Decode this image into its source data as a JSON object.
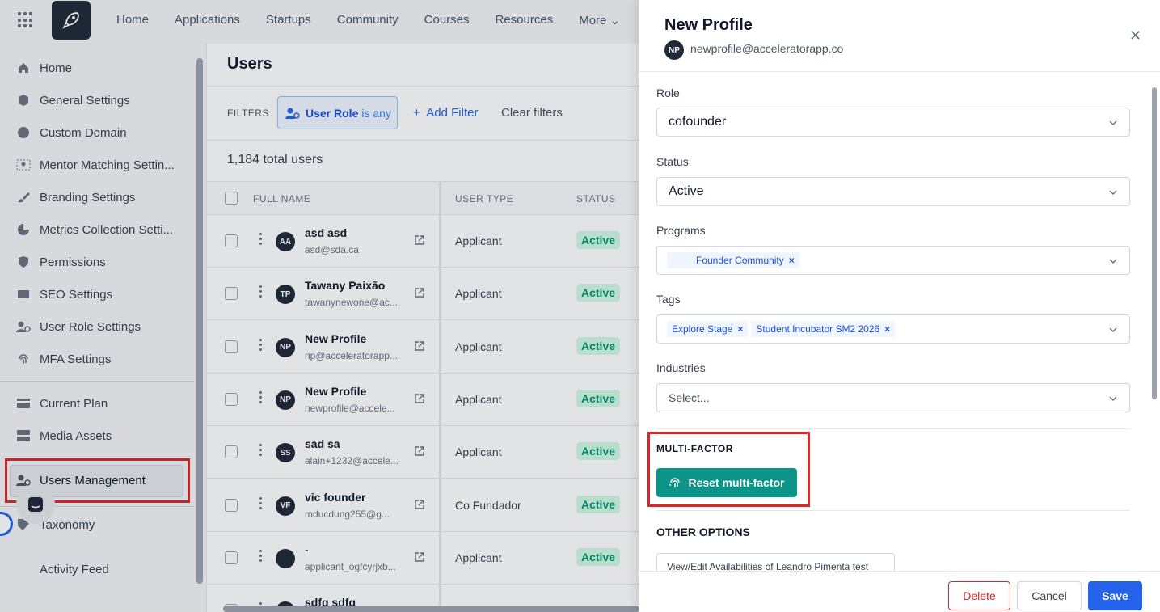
{
  "topnav": {
    "items": [
      "Home",
      "Applications",
      "Startups",
      "Community",
      "Courses",
      "Resources",
      "More"
    ]
  },
  "sidebar": {
    "items": [
      {
        "label": "Home",
        "icon": "home-icon"
      },
      {
        "label": "General Settings",
        "icon": "cube-icon"
      },
      {
        "label": "Custom Domain",
        "icon": "globe-icon"
      },
      {
        "label": "Mentor Matching Settin...",
        "icon": "users-icon"
      },
      {
        "label": "Branding Settings",
        "icon": "brush-icon"
      },
      {
        "label": "Metrics Collection Setti...",
        "icon": "pie-chart-icon"
      },
      {
        "label": "Permissions",
        "icon": "shield-icon"
      },
      {
        "label": "SEO Settings",
        "icon": "seo-icon"
      },
      {
        "label": "User Role Settings",
        "icon": "user-gear-icon"
      },
      {
        "label": "MFA Settings",
        "icon": "fingerprint-icon"
      },
      {
        "label": "Current Plan",
        "icon": "card-icon"
      },
      {
        "label": "Media Assets",
        "icon": "server-icon"
      },
      {
        "label": "Users Management",
        "icon": "user-gear-icon"
      },
      {
        "label": "Taxonomy",
        "icon": "tag-icon"
      },
      {
        "label": "Activity Feed",
        "icon": "feed-icon"
      }
    ]
  },
  "main": {
    "title": "Users",
    "filters_label": "FILTERS",
    "role_filter": {
      "label": "User Role",
      "value": "is any"
    },
    "add_filter": "Add Filter",
    "clear_filters": "Clear filters",
    "total": "1,184 total users",
    "columns": [
      "FULL NAME",
      "USER TYPE",
      "STATUS"
    ],
    "rows": [
      {
        "initials": "AA",
        "name": "asd asd",
        "email": "asd@sda.ca",
        "type": "Applicant",
        "status": "Active"
      },
      {
        "initials": "TP",
        "name": "Tawany Paixão",
        "email": "tawanynewone@ac...",
        "type": "Applicant",
        "status": "Active"
      },
      {
        "initials": "NP",
        "name": "New Profile",
        "email": "np@acceleratorapp...",
        "type": "Applicant",
        "status": "Active"
      },
      {
        "initials": "NP",
        "name": "New Profile",
        "email": "newprofile@accele...",
        "type": "Applicant",
        "status": "Active"
      },
      {
        "initials": "SS",
        "name": "sad sa",
        "email": "alain+1232@accele...",
        "type": "Applicant",
        "status": "Active"
      },
      {
        "initials": "VF",
        "name": "vic founder",
        "email": "mducdung255@g...",
        "type": "Co Fundador",
        "status": "Active"
      },
      {
        "initials": "",
        "name": "-",
        "email": "applicant_ogfcyrjxb...",
        "type": "Applicant",
        "status": "Active"
      },
      {
        "initials": "",
        "name": "sdfg sdfg",
        "email": "",
        "type": "",
        "status": ""
      }
    ]
  },
  "drawer": {
    "title": "New Profile",
    "initials": "NP",
    "email": "newprofile@acceleratorapp.co",
    "role_label": "Role",
    "role_value": "cofounder",
    "status_label": "Status",
    "status_value": "Active",
    "programs_label": "Programs",
    "programs": [
      "Founder Community"
    ],
    "tags_label": "Tags",
    "tags": [
      "Explore Stage",
      "Student Incubator SM2 2026"
    ],
    "industries_label": "Industries",
    "industries_placeholder": "Select...",
    "mfa_title": "MULTI-FACTOR",
    "mfa_button": "Reset multi-factor",
    "other_title": "OTHER OPTIONS",
    "availability_button": "View/Edit Availabilities of Leandro Pimenta test",
    "delete": "Delete",
    "cancel": "Cancel",
    "save": "Save"
  },
  "colors": {
    "primary": "#2563eb",
    "mfa_button": "#0d9488",
    "danger": "#dc2626",
    "status_active": "#059669"
  }
}
